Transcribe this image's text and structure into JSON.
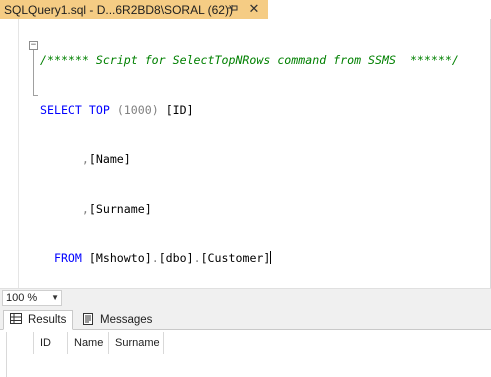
{
  "tab": {
    "title": "SQLQuery1.sql - D...6R2BD8\\SORAL (62))",
    "pin_icon": "pin-icon",
    "close_label": "✕"
  },
  "editor": {
    "lines": [
      {
        "comment": "/****** Script for SelectTopNRows command from SSMS  ******/"
      },
      {
        "kw1": "SELECT",
        "kw2": "TOP",
        "num": "(1000)",
        "col": "[ID]"
      },
      {
        "sep": ",",
        "col": "[Name]"
      },
      {
        "sep": ",",
        "col": "[Surname]"
      },
      {
        "kw": "FROM",
        "db": "[Mshowto]",
        "schema": "[dbo]",
        "table": "[Customer]",
        "dot": "."
      }
    ],
    "fold_symbol": "−"
  },
  "zoom": {
    "value": "100 %"
  },
  "results": {
    "tabs": [
      {
        "label": "Results",
        "icon": "grid-icon"
      },
      {
        "label": "Messages",
        "icon": "messages-icon"
      }
    ],
    "columns": [
      "ID",
      "Name",
      "Surname"
    ]
  },
  "colors": {
    "tab_active": "#f5cc84",
    "keyword": "#0000ff",
    "comment": "#008000",
    "operator": "#808080"
  }
}
